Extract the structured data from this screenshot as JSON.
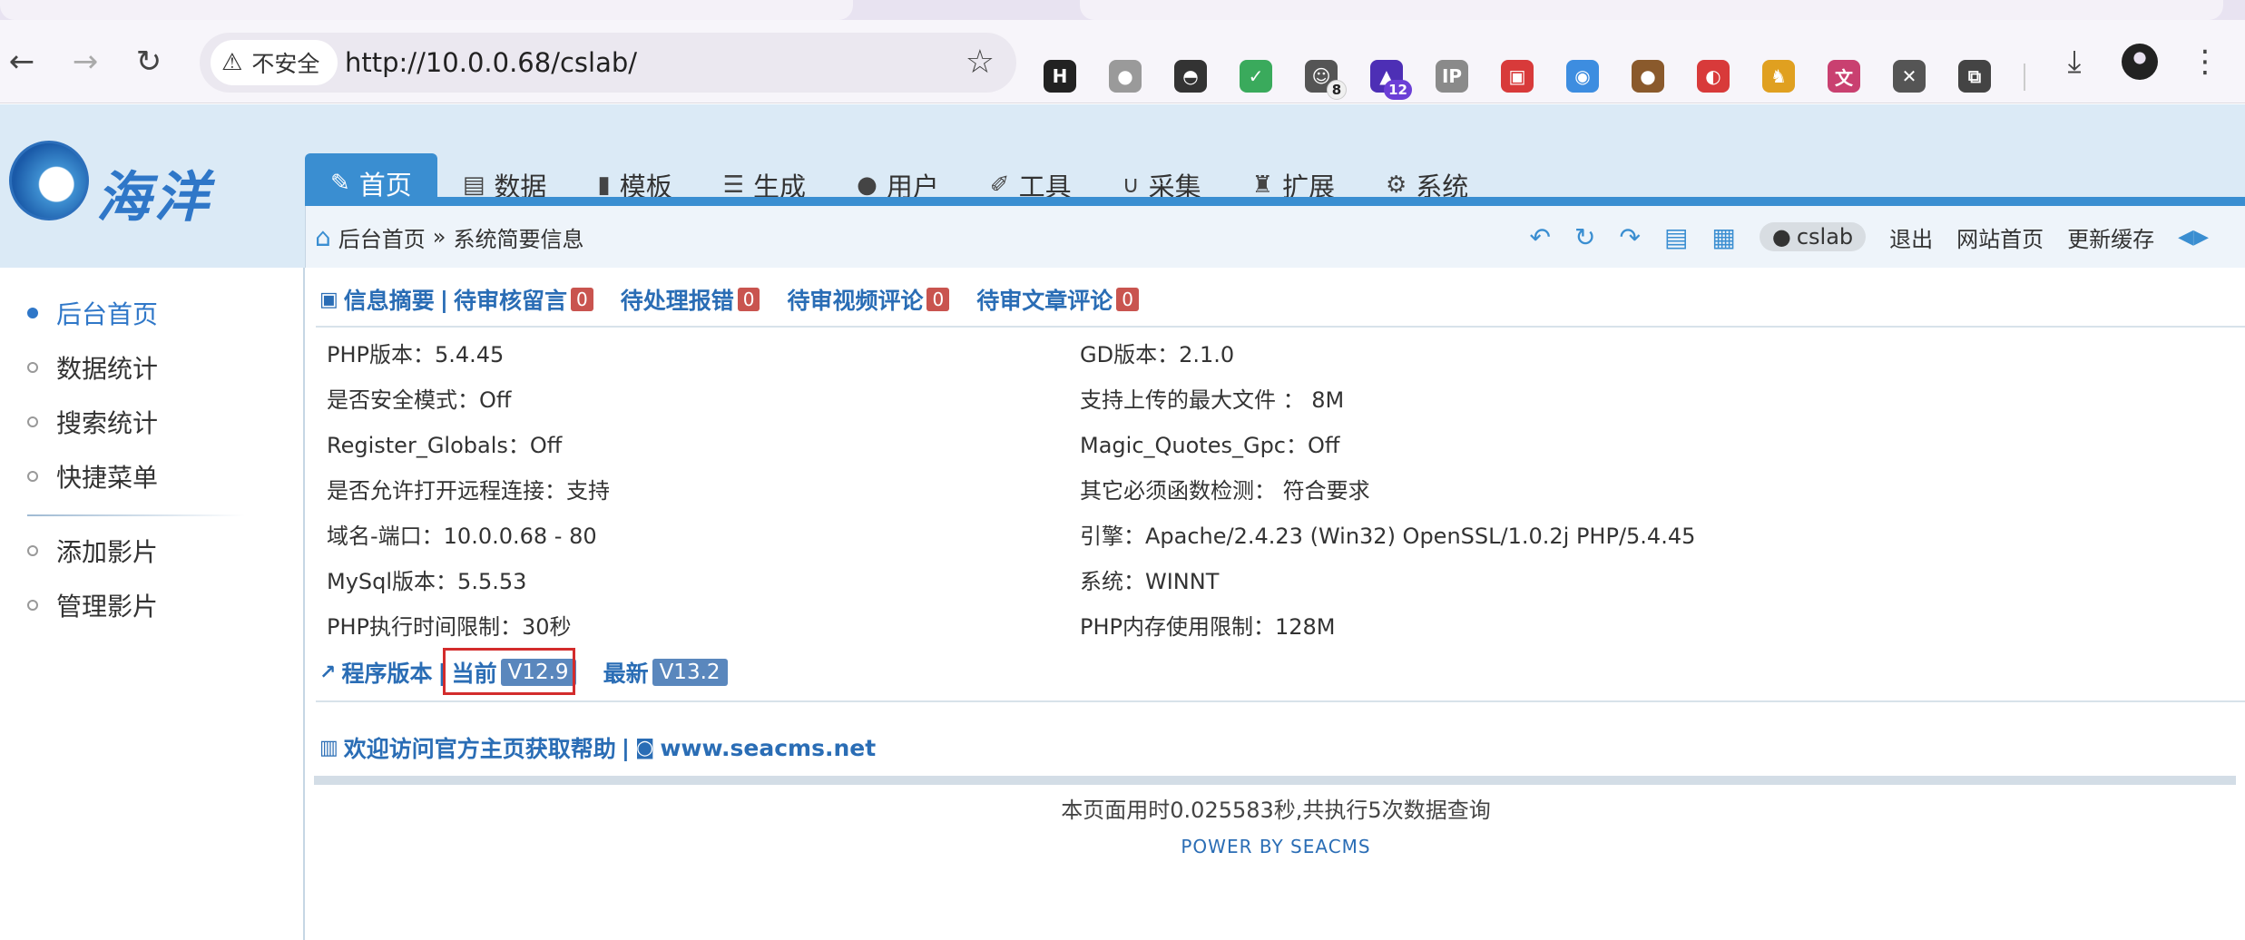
{
  "browser": {
    "security_label": "不安全",
    "url": "http://10.0.0.68/cslab/",
    "extensions": [
      {
        "name": "hack-bar",
        "label": "H",
        "color": "#222222"
      },
      {
        "name": "record",
        "label": "●",
        "color": "#9a9a9a"
      },
      {
        "name": "hat",
        "label": "◓",
        "color": "#333333"
      },
      {
        "name": "shield",
        "label": "✓",
        "color": "#3aaa5c"
      },
      {
        "name": "panda",
        "label": "☺",
        "color": "#555555",
        "badge": "8"
      },
      {
        "name": "graduation",
        "label": "▲",
        "color": "#4d2fb5",
        "badge": "12"
      },
      {
        "name": "ip",
        "label": "IP",
        "color": "#8a8a8a"
      },
      {
        "name": "glasses",
        "label": "▣",
        "color": "#d83a3a"
      },
      {
        "name": "mask",
        "label": "◉",
        "color": "#3d8de0"
      },
      {
        "name": "cookie",
        "label": "●",
        "color": "#8a5a2c"
      },
      {
        "name": "pokeball",
        "label": "◐",
        "color": "#d83a3a"
      },
      {
        "name": "cat",
        "label": "♞",
        "color": "#e0a020"
      },
      {
        "name": "translate",
        "label": "文",
        "color": "#c94070"
      },
      {
        "name": "blocker",
        "label": "✕",
        "color": "#555555"
      },
      {
        "name": "puzzle",
        "label": "⧉",
        "color": "#444444"
      }
    ]
  },
  "logo": {
    "text": "海洋"
  },
  "nav": {
    "tabs": [
      {
        "label": "首页",
        "icon": "✎",
        "active": true
      },
      {
        "label": "数据",
        "icon": "▤"
      },
      {
        "label": "模板",
        "icon": "▮"
      },
      {
        "label": "生成",
        "icon": "☰"
      },
      {
        "label": "用户",
        "icon": "●"
      },
      {
        "label": "工具",
        "icon": "✐"
      },
      {
        "label": "采集",
        "icon": "∪"
      },
      {
        "label": "扩展",
        "icon": "♜"
      },
      {
        "label": "系统",
        "icon": "⚙"
      }
    ]
  },
  "breadcrumb": {
    "home": "后台首页",
    "sep": "»",
    "current": "系统简要信息"
  },
  "quick": {
    "user": "cslab",
    "logout": "退出",
    "site_home": "网站首页",
    "update_cache": "更新缓存"
  },
  "sidebar": {
    "items": [
      {
        "label": "后台首页",
        "active": true
      },
      {
        "label": "数据统计"
      },
      {
        "label": "搜索统计"
      },
      {
        "label": "快捷菜单"
      },
      {
        "label": "添加影片"
      },
      {
        "label": "管理影片"
      }
    ]
  },
  "summary": {
    "title": "信息摘要",
    "sep": "|",
    "pending_comments_label": "待审核留言",
    "pending_comments_count": "0",
    "pending_errors_label": "待处理报错",
    "pending_errors_count": "0",
    "pending_video_label": "待审视频评论",
    "pending_video_count": "0",
    "pending_article_label": "待审文章评论",
    "pending_article_count": "0"
  },
  "info": {
    "left": [
      "PHP版本：5.4.45",
      "是否安全模式：Off",
      "Register_Globals：Off",
      "是否允许打开远程连接：支持",
      "域名-端口：10.0.0.68 - 80",
      "MySql版本：5.5.53",
      "PHP执行时间限制：30秒"
    ],
    "right": [
      "GD版本：2.1.0",
      "支持上传的最大文件 ： 8M",
      "Magic_Quotes_Gpc：Off",
      "其它必须函数检测： 符合要求",
      "引擎：Apache/2.4.23 (Win32) OpenSSL/1.0.2j PHP/5.4.45",
      "系统：WINNT",
      "PHP内存使用限制：128M"
    ]
  },
  "version": {
    "title": "程序版本",
    "sep": "|",
    "current_label": "当前",
    "current_value": "V12.9",
    "latest_label": "最新",
    "latest_value": "V13.2"
  },
  "help": {
    "text": "欢迎访问官方主页获取帮助",
    "sep": "|",
    "site": "www.seacms.net"
  },
  "footer": {
    "time": "本页面用时0.025583秒,共执行5次数据查询",
    "power": "POWER BY SEACMS"
  }
}
